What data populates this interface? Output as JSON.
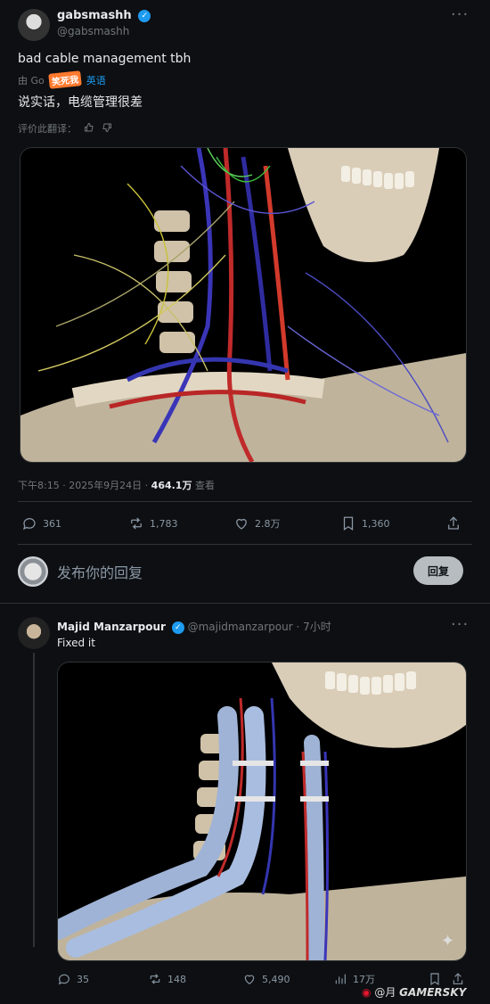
{
  "post": {
    "author": "gabsmashh",
    "handle": "@gabsmashh",
    "text": "bad cable management tbh",
    "translate_prefix": "由 Go",
    "translate_suffix": "英语",
    "sticker": "笑死我",
    "translation": "说实话，电缆管理很差",
    "rate_translation": "评价此翻译：",
    "timestamp": "下午8:15 · 2025年9月24日 · ",
    "views": "464.1万",
    "views_label": " 查看",
    "replies": "361",
    "reposts": "1,783",
    "likes": "2.8万",
    "bookmarks": "1,360"
  },
  "compose": {
    "placeholder": "发布你的回复",
    "button": "回复"
  },
  "reply": {
    "author": "Majid Manzarpour",
    "handle_time": "@majidmanzarpour · 7小时",
    "text": "Fixed it",
    "replies": "35",
    "reposts": "148",
    "likes": "5,490",
    "views": "17万"
  },
  "watermark": {
    "text": "@月",
    "brand": "GAMERSKY"
  },
  "colors": {
    "background": "#0d0f12",
    "verified": "#1d9bf0",
    "text": "#e7e9ea",
    "muted": "#71767b"
  }
}
